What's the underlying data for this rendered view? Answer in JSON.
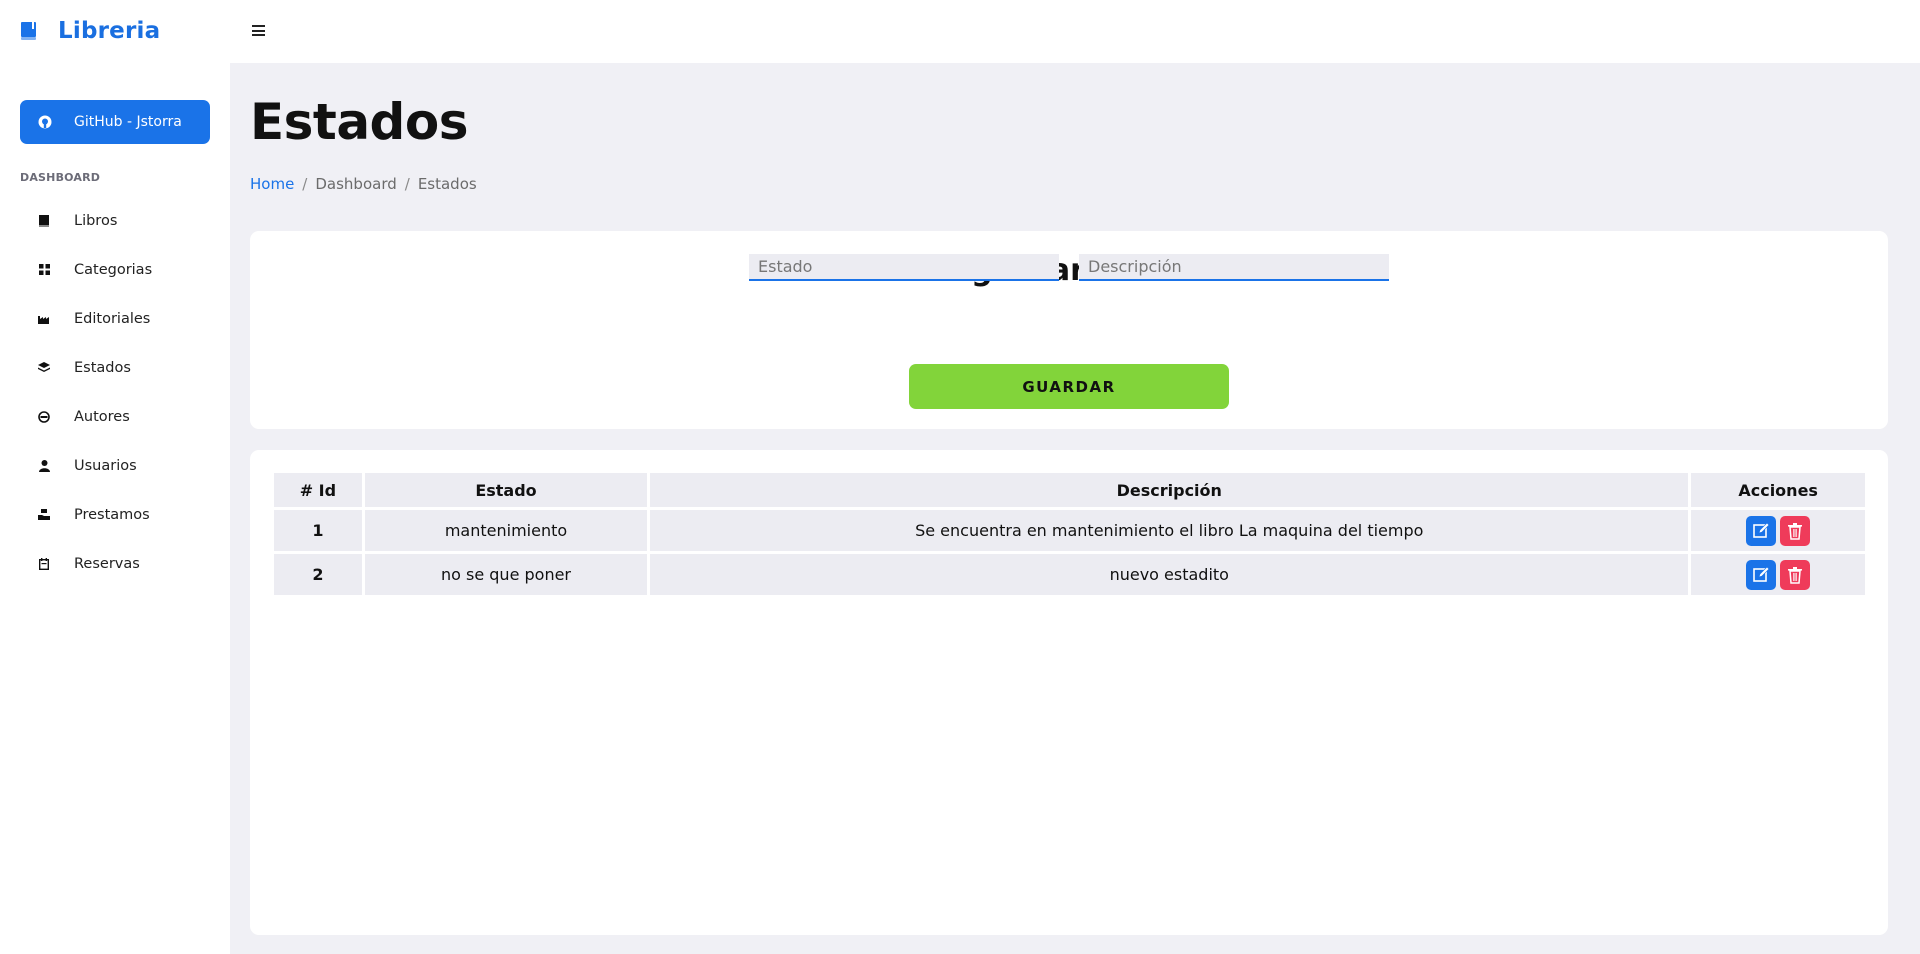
{
  "brand": {
    "name": "Libreria",
    "icon": "book-icon"
  },
  "sidebar": {
    "github_button": {
      "label": "GitHub - Jstorra",
      "icon": "github-icon"
    },
    "section_label": "DASHBOARD",
    "items": [
      {
        "label": "Libros",
        "icon": "book-icon"
      },
      {
        "label": "Categorias",
        "icon": "grid-icon"
      },
      {
        "label": "Editoriales",
        "icon": "factory-icon"
      },
      {
        "label": "Estados",
        "icon": "layers-icon"
      },
      {
        "label": "Autores",
        "icon": "mask-icon"
      },
      {
        "label": "Usuarios",
        "icon": "person-icon"
      },
      {
        "label": "Prestamos",
        "icon": "hand-box-icon"
      },
      {
        "label": "Reservas",
        "icon": "calendar-icon"
      }
    ]
  },
  "topbar": {
    "menu_icon": "hamburger-icon"
  },
  "page": {
    "title": "Estados",
    "breadcrumb": [
      "Home",
      "Dashboard",
      "Estados"
    ]
  },
  "form": {
    "title": "Registrar estado",
    "estado_placeholder": "Estado",
    "descripcion_placeholder": "Descripción",
    "estado_value": "",
    "descripcion_value": "",
    "save_label": "GUARDAR"
  },
  "table": {
    "headers": [
      "# Id",
      "Estado",
      "Descripción",
      "Acciones"
    ],
    "rows": [
      {
        "id": "1",
        "estado": "mantenimiento",
        "descripcion": "Se encuentra en mantenimiento el libro La maquina del tiempo"
      },
      {
        "id": "2",
        "estado": "no se que poner",
        "descripcion": "nuevo estadito"
      }
    ],
    "edit_icon": "edit-icon",
    "delete_icon": "trash-icon"
  },
  "colors": {
    "primary": "#1a73e8",
    "brand_text": "#1a6fe0",
    "success": "#82d43a",
    "danger": "#ef3b5a",
    "background": "#f0f0f5"
  }
}
